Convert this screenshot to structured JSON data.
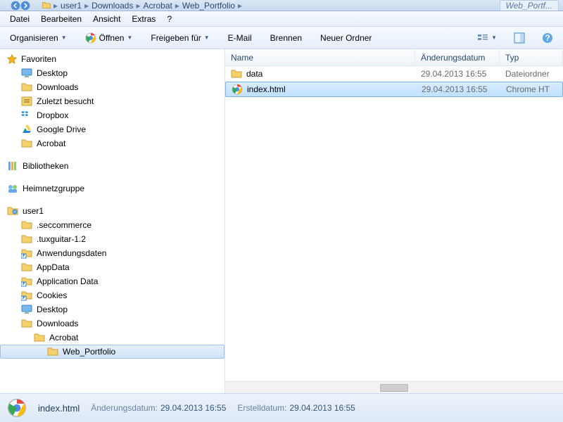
{
  "breadcrumb": {
    "segments": [
      "user1",
      "Downloads",
      "Acrobat",
      "Web_Portfolio"
    ]
  },
  "tabstub_text": "Web_Portf...",
  "menu": {
    "file": "Datei",
    "edit": "Bearbeiten",
    "view": "Ansicht",
    "extras": "Extras",
    "help": "?"
  },
  "toolbar": {
    "organize": "Organisieren",
    "open": "Öffnen",
    "share": "Freigeben für",
    "email": "E-Mail",
    "burn": "Brennen",
    "new_folder": "Neuer Ordner"
  },
  "sidebar": {
    "favorites": "Favoriten",
    "fav_items": [
      {
        "label": "Desktop",
        "icon": "desktop"
      },
      {
        "label": "Downloads",
        "icon": "folder"
      },
      {
        "label": "Zuletzt besucht",
        "icon": "recent"
      },
      {
        "label": "Dropbox",
        "icon": "dropbox"
      },
      {
        "label": "Google Drive",
        "icon": "gdrive"
      },
      {
        "label": "Acrobat",
        "icon": "folder"
      }
    ],
    "libraries": "Bibliotheken",
    "homegroup": "Heimnetzgruppe",
    "user_root": "user1",
    "user_items": [
      {
        "label": ".seccommerce",
        "icon": "folder",
        "indent": 1
      },
      {
        "label": ".tuxguitar-1.2",
        "icon": "folder",
        "indent": 1
      },
      {
        "label": "Anwendungsdaten",
        "icon": "shortcut-folder",
        "indent": 1
      },
      {
        "label": "AppData",
        "icon": "folder",
        "indent": 1
      },
      {
        "label": "Application Data",
        "icon": "shortcut-folder",
        "indent": 1
      },
      {
        "label": "Cookies",
        "icon": "shortcut-folder",
        "indent": 1
      },
      {
        "label": "Desktop",
        "icon": "desktop",
        "indent": 1
      },
      {
        "label": "Downloads",
        "icon": "folder",
        "indent": 1
      },
      {
        "label": "Acrobat",
        "icon": "folder",
        "indent": 2
      },
      {
        "label": "Web_Portfolio",
        "icon": "folder",
        "indent": 3,
        "selected": true
      }
    ]
  },
  "columns": {
    "name": "Name",
    "date": "Änderungsdatum",
    "type": "Typ"
  },
  "files": [
    {
      "name": "data",
      "icon": "folder",
      "date": "29.04.2013 16:55",
      "type": "Dateiordner",
      "selected": false
    },
    {
      "name": "index.html",
      "icon": "chrome",
      "date": "29.04.2013 16:55",
      "type": "Chrome HT",
      "selected": true
    }
  ],
  "details": {
    "filename": "index.html",
    "mod_label": "Änderungsdatum:",
    "mod_value": "29.04.2013 16:55",
    "create_label": "Erstelldatum:",
    "create_value": "29.04.2013 16:55"
  }
}
